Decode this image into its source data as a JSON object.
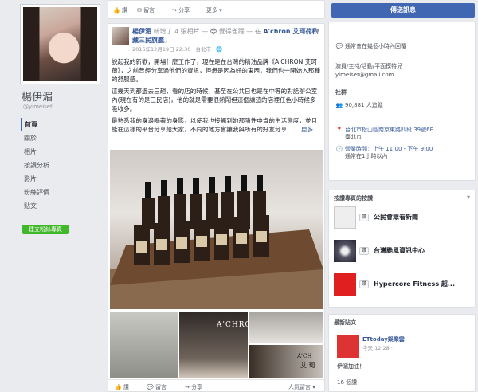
{
  "profile": {
    "name": "楊伊湄",
    "handle": "@yimeiset",
    "nav": [
      {
        "label": "首頁",
        "active": true
      },
      {
        "label": "關於",
        "active": false
      },
      {
        "label": "相片",
        "active": false
      },
      {
        "label": "按讚分析",
        "active": false
      },
      {
        "label": "影片",
        "active": false
      },
      {
        "label": "粉絲評價",
        "active": false
      },
      {
        "label": "貼文",
        "active": false
      }
    ],
    "create_page": "建立粉絲專頁"
  },
  "topbar": {
    "like": "讚",
    "comment": "留言",
    "share": "分享",
    "more": "更多"
  },
  "post": {
    "author": "楊伊湄",
    "action": "新增了 4 張相片 —",
    "feeling": "覺得雀躍",
    "location_prefix": "— 在",
    "location": "A'chron 艾珂荷私藏三民旗艦",
    "location_suffix": "。",
    "time": "2016年12月19日 22:30 · 台北市 ·",
    "paragraphs": [
      "說起我的新歡，開場什麼工作了，現在是在台灣的精油品牌《A'CHRON 艾珂荷》，之前曾經分享過他們的資訊，但想是因為好的東西，我們也一開始入那種的舒服感。",
      "這幾天到那邊去三趟，看的店的時候，基至在公共日也是在中等的對話辦公室內(現在有的是三民店)，他的就是需要很熱鬧但這個讓這的店裡任色小時候多吸收多。",
      "最熟悉我的身邊喝著的身影，以使我也接觸到她那隨性中肯的生活態度，並且能在這樣的平台分享給大家，不同的地方會讓我與所有的好友分享……"
    ],
    "see_more": "更多",
    "photo_brand": "A'CHRON",
    "photo_brand_2": "A'CH",
    "photo_brand_3": "艾 珂",
    "actions": {
      "like": "讚",
      "comment": "留言",
      "share": "分享",
      "viewer": "人氣留言"
    }
  },
  "right": {
    "send_message": "傳送訊息",
    "about": {
      "reply_note": "通常會在幾個小時內回覆",
      "role": "演員/主持/活動/平面模特兒",
      "email": "yimeiset@gmail.com",
      "community": "社群",
      "followers_label": "90,881 人追蹤",
      "address_line1": "台北市松山區南京東路四段 39號6F",
      "address_line2": "臺北市",
      "hours": "營業時間：上午 11:00 - 下午 9:00",
      "hours_note": "通常在1小時以內"
    },
    "liked_pages": {
      "title": "按讚專頁的按讚",
      "pages": [
        {
          "name": "公民會眾看新聞",
          "like": "讚"
        },
        {
          "name": "台灣颱風資訊中心",
          "like": "讚"
        },
        {
          "name": "Hypercore Fitness 超...",
          "like": "讚"
        }
      ]
    },
    "recent": {
      "title": "最新貼文",
      "name": "ETtoday娛樂雲",
      "time": "今天 12:28 ·",
      "text": "伊湄加油！",
      "likes": "16 個讚"
    }
  }
}
